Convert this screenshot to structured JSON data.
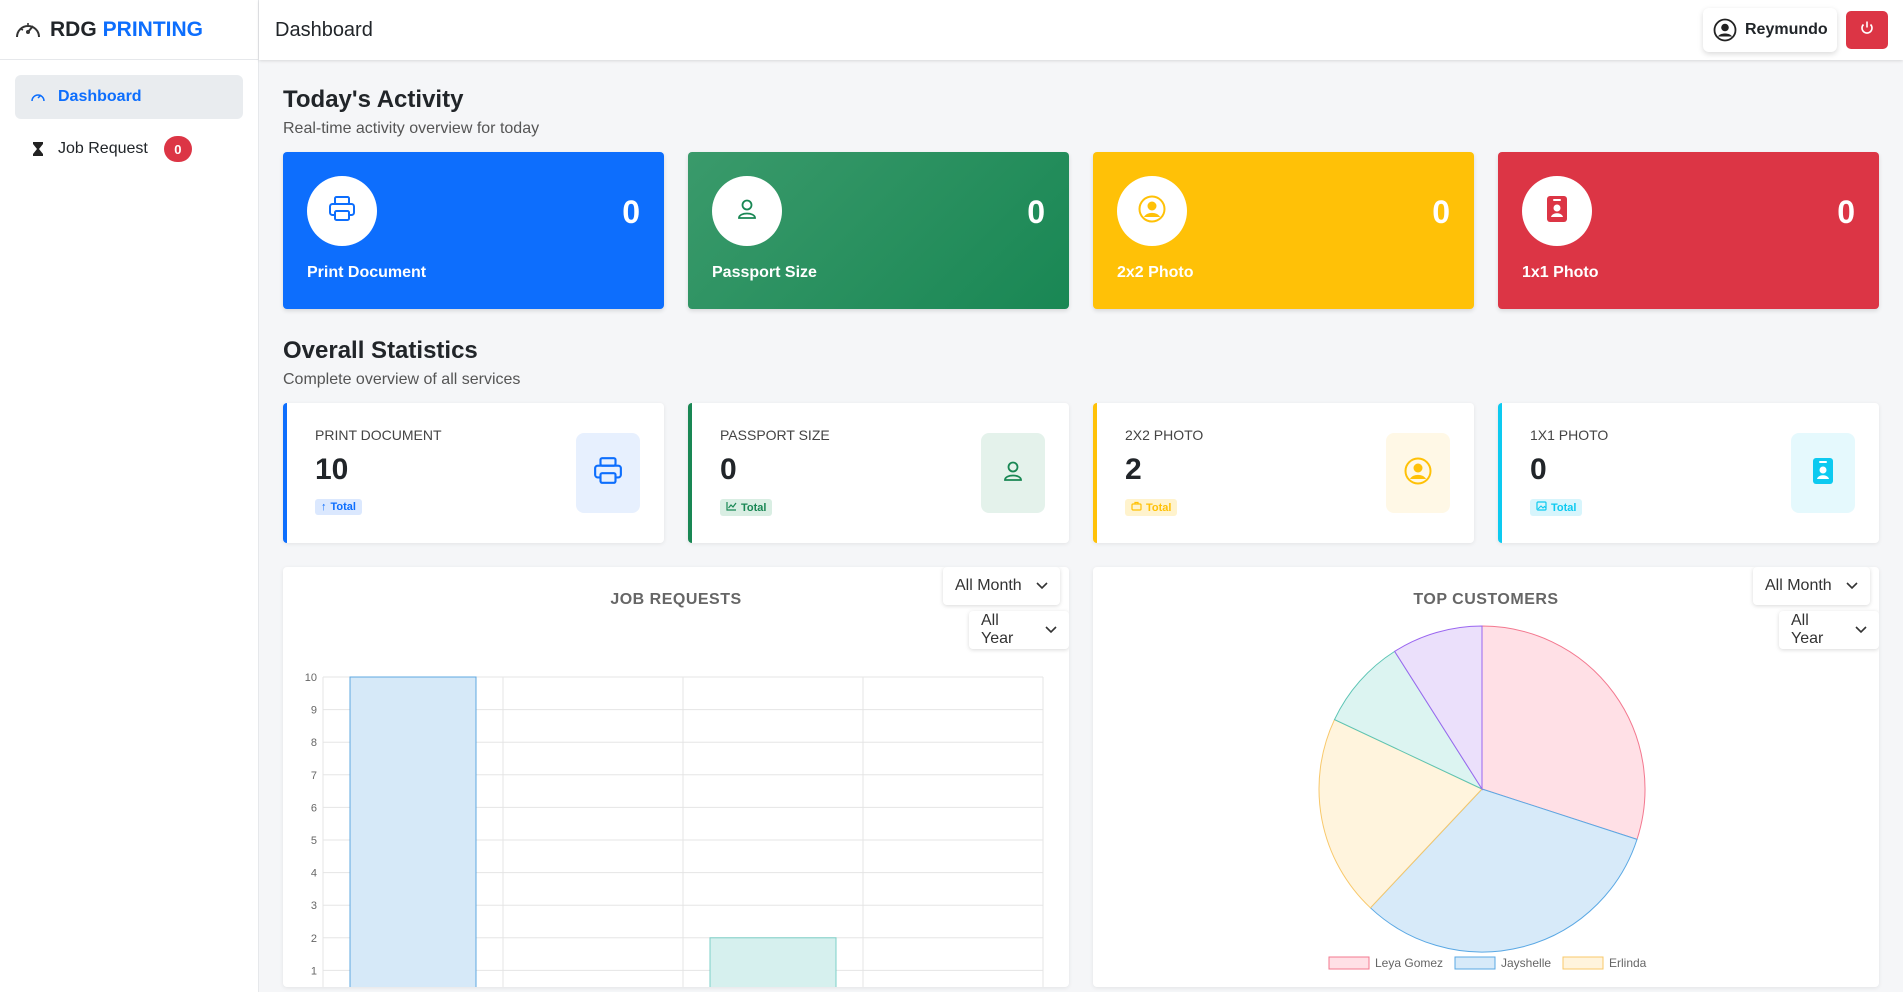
{
  "brand": {
    "part1": "RDG",
    "part2": "PRINTING"
  },
  "sidebar": {
    "items": [
      {
        "label": "Dashboard"
      },
      {
        "label": "Job Request",
        "badge": "0"
      }
    ]
  },
  "topbar": {
    "title": "Dashboard",
    "user": "Reymundo"
  },
  "activity": {
    "title": "Today's Activity",
    "subtitle": "Real-time activity overview for today",
    "cards": [
      {
        "label": "Print Document",
        "value": "0",
        "color": "#0d6efd"
      },
      {
        "label": "Passport Size",
        "value": "0",
        "color": "#198754"
      },
      {
        "label": "2x2 Photo",
        "value": "0",
        "color": "#ffc107"
      },
      {
        "label": "1x1 Photo",
        "value": "0",
        "color": "#dc3545"
      }
    ]
  },
  "stats": {
    "title": "Overall Statistics",
    "subtitle": "Complete overview of all services",
    "cards": [
      {
        "name": "PRINT DOCUMENT",
        "value": "10",
        "tag": "Total",
        "color": "#0d6efd"
      },
      {
        "name": "PASSPORT SIZE",
        "value": "0",
        "tag": "Total",
        "color": "#198754"
      },
      {
        "name": "2X2 PHOTO",
        "value": "2",
        "tag": "Total",
        "color": "#ffc107"
      },
      {
        "name": "1X1 PHOTO",
        "value": "0",
        "tag": "Total",
        "color": "#0dcaf0"
      }
    ]
  },
  "filters": {
    "month": "All Month",
    "year": "All Year"
  },
  "chart_data": [
    {
      "type": "bar",
      "title": "JOB REQUESTS",
      "categories": [
        "",
        "",
        "",
        ""
      ],
      "values": [
        10,
        0,
        2,
        0
      ],
      "colors": [
        "#d6e9f8",
        "",
        "#d6f0ee",
        ""
      ],
      "borders": [
        "#5fa8e0",
        "",
        "#7cd0c8",
        ""
      ],
      "yticks": [
        1,
        2,
        3,
        4,
        5,
        6,
        7,
        8,
        9,
        10
      ],
      "ylim": [
        0,
        10
      ]
    },
    {
      "type": "pie",
      "title": "TOP CUSTOMERS",
      "labels": [
        "Leya Gomez",
        "Jayshelle",
        "Erlinda",
        "",
        ""
      ],
      "values": [
        30,
        32,
        20,
        9,
        9
      ],
      "colors": [
        "#ffe0e6",
        "#d7eaf9",
        "#fff4dd",
        "#dcf4f1",
        "#ebe0fb"
      ],
      "borders": [
        "#f3788f",
        "#5aa8e4",
        "#f8c86a",
        "#5cc4b4",
        "#9a66f0"
      ]
    }
  ]
}
